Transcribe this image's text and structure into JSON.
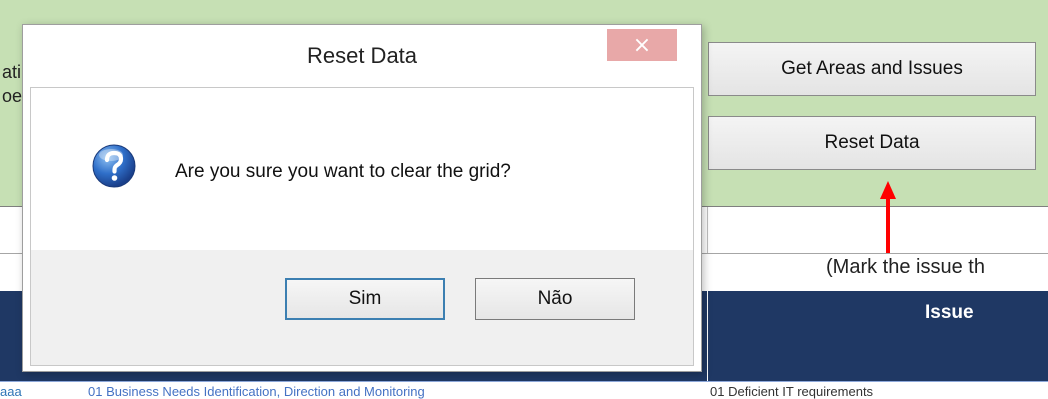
{
  "sheet": {
    "cut_left_line1": "ati",
    "cut_left_line2": "oe",
    "get_areas_button": "Get Areas and Issues",
    "reset_data_button": "Reset Data",
    "mark_note": "(Mark the issue th",
    "issue_header": "Issue",
    "row_left_partial": "aaa",
    "row_area_text": "01 Business Needs Identification, Direction and Monitoring",
    "row_issue_text": "01 Deficient IT requirements"
  },
  "dialog": {
    "title": "Reset Data",
    "close_label": "×",
    "message": "Are you sure you want to clear the grid?",
    "yes_label": "Sim",
    "no_label": "Não"
  },
  "icons": {
    "question": "question-icon",
    "arrow": "arrow-up-icon"
  },
  "colors": {
    "sheet_green": "#c6e0b4",
    "header_navy": "#1f3864",
    "annotation_red": "#ff0000",
    "close_hover_red": "#e8a8a8"
  }
}
